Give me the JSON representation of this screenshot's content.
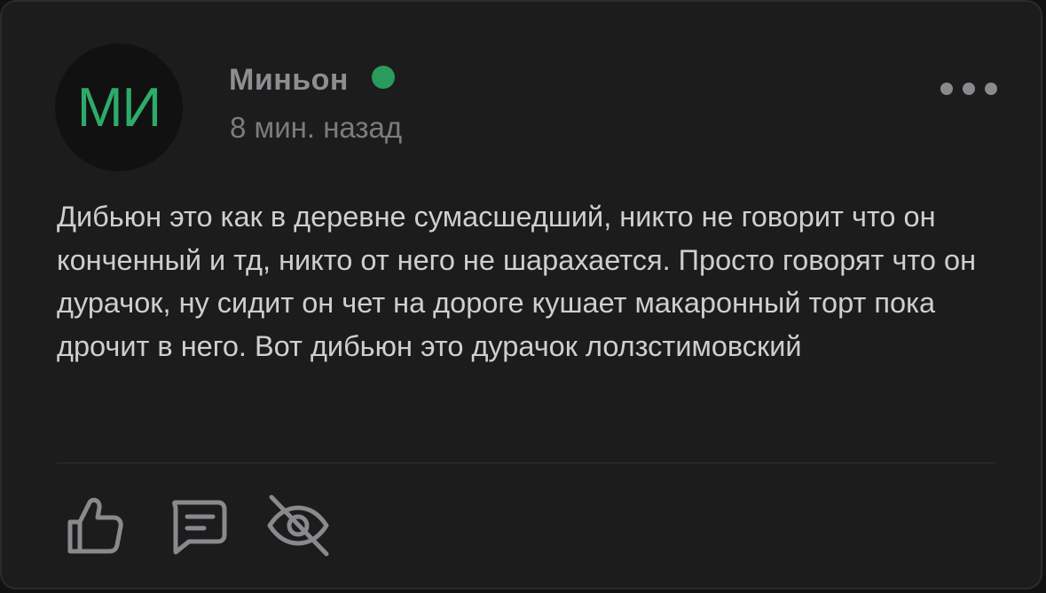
{
  "post": {
    "avatar_initials": "МИ",
    "author_name": "Миньон",
    "online_status_color": "#2a9b5c",
    "timestamp": "8 мин. назад",
    "text": "Дибьюн это как в деревне сумасшедший, никто не говорит что он конченный и тд, никто от него не шарахается. Просто говорят что он дурачок, ну сидит он чет на дороге кушает макаронный торт пока дрочит в него. Вот дибьюн это дурачок лолзстимовский"
  },
  "actions": {
    "icons": [
      "more-horizontal-icon",
      "thumbs-up-icon",
      "comment-icon",
      "eye-off-icon"
    ]
  },
  "colors": {
    "background": "#1c1c1d",
    "accent": "#2eaa6b",
    "text": "#cfcfd2",
    "muted": "#8e8e92"
  }
}
